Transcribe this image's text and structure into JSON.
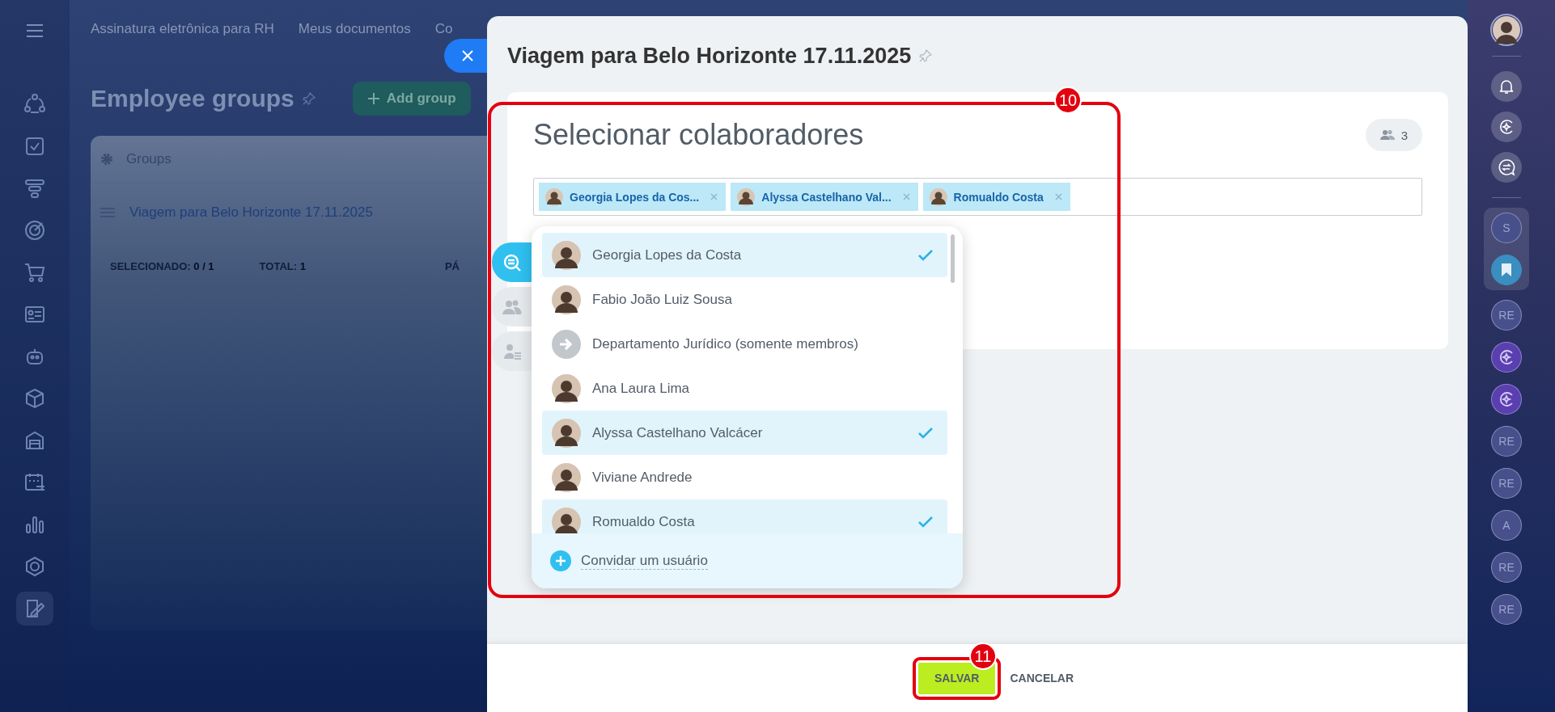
{
  "left_nav": [
    {
      "kind": "flow",
      "selected": false
    },
    {
      "kind": "tasks",
      "selected": false
    },
    {
      "kind": "funnel",
      "selected": false
    },
    {
      "kind": "target",
      "selected": false
    },
    {
      "kind": "cart",
      "selected": false
    },
    {
      "kind": "card",
      "selected": false
    },
    {
      "kind": "robot",
      "selected": false
    },
    {
      "kind": "box",
      "selected": false
    },
    {
      "kind": "warehouse",
      "selected": false
    },
    {
      "kind": "calendar",
      "selected": false
    },
    {
      "kind": "chart",
      "selected": false
    },
    {
      "kind": "hexagon",
      "selected": false
    },
    {
      "kind": "sign",
      "selected": true
    }
  ],
  "top_tabs": [
    "Assinatura eletrônica para RH",
    "Meus documentos",
    "Co"
  ],
  "page": {
    "title": "Employee groups",
    "add_button": "Add group",
    "table": {
      "header": "Groups",
      "rows": [
        "Viagem para Belo Horizonte 17.11.2025"
      ],
      "footer": [
        {
          "label": "SELECIONADO:",
          "value": "0 / 1"
        },
        {
          "label": "TOTAL:",
          "value": "1"
        },
        {
          "label": "PÁ"
        }
      ]
    }
  },
  "slider": {
    "title": "Viagem para Belo Horizonte 17.11.2025",
    "selector": {
      "annotation": "10",
      "heading": "Selecionar colaboradores",
      "count": "3",
      "tags": [
        "Georgia Lopes da Cos...",
        "Alyssa Castelhano Val...",
        "Romualdo Costa"
      ],
      "side_tabs": [
        {
          "kind": "search",
          "selected": true
        },
        {
          "kind": "groups",
          "selected": false
        },
        {
          "kind": "list",
          "selected": false
        }
      ],
      "items": [
        {
          "kind": "person",
          "name": "Georgia Lopes da Costa",
          "selected": true
        },
        {
          "kind": "person",
          "name": "Fabio João Luiz Sousa",
          "selected": false
        },
        {
          "kind": "department",
          "name": "Departamento Jurídico (somente membros)",
          "selected": false
        },
        {
          "kind": "person",
          "name": "Ana Laura Lima",
          "selected": false
        },
        {
          "kind": "person",
          "name": "Alyssa Castelhano Valcácer",
          "selected": true
        },
        {
          "kind": "person",
          "name": "Viviane Andrede",
          "selected": false
        },
        {
          "kind": "person",
          "name": "Romualdo Costa",
          "selected": true
        }
      ],
      "invite": "Convidar um usuário"
    },
    "buttons": [
      {
        "kind": "save",
        "label": "SALVAR",
        "annotation": "11"
      },
      {
        "kind": "cancel",
        "label": "CANCELAR"
      }
    ]
  },
  "right_rail": [
    {
      "kind": "avatar"
    },
    {
      "kind": "bell"
    },
    {
      "kind": "copilot"
    },
    {
      "kind": "chat"
    },
    {
      "kind": "letter",
      "text": "S",
      "grouped": true
    },
    {
      "kind": "bookmark",
      "grouped": true
    },
    {
      "kind": "letter",
      "text": "RE",
      "grouped": false
    },
    {
      "kind": "copilot-purple",
      "grouped": false
    },
    {
      "kind": "copilot-purple",
      "grouped": false
    },
    {
      "kind": "letter",
      "text": "RE",
      "grouped": false
    },
    {
      "kind": "letter",
      "text": "RE",
      "grouped": false
    },
    {
      "kind": "letter",
      "text": "A",
      "grouped": false
    },
    {
      "kind": "letter",
      "text": "RE",
      "grouped": false
    },
    {
      "kind": "letter",
      "text": "RE",
      "grouped": false
    }
  ]
}
